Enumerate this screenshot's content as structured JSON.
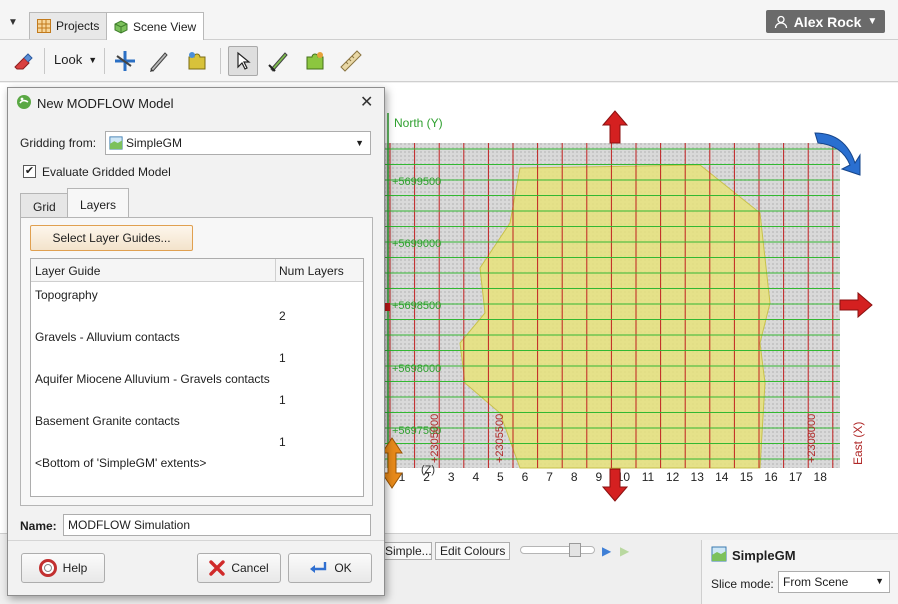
{
  "tabs": [
    {
      "label": "Projects",
      "icon": "grid-icon"
    },
    {
      "label": "Scene View",
      "icon": "cube-icon"
    }
  ],
  "user": {
    "name": "Alex Rock"
  },
  "toolbar": {
    "look_label": "Look"
  },
  "scene": {
    "north_label": "North (Y)",
    "east_label": "East (X)",
    "z_label": "(Z)",
    "northings": [
      "+5699500",
      "+5699000",
      "+5698500",
      "+5698000",
      "+5697500"
    ],
    "eastings": [
      "+2305000",
      "+2305500",
      "+2308000"
    ],
    "col_numbers": [
      "1",
      "2",
      "3",
      "4",
      "5",
      "6",
      "7",
      "8",
      "9",
      "10",
      "11",
      "12",
      "13",
      "14",
      "15",
      "16",
      "17",
      "18"
    ]
  },
  "bottom": {
    "style_value": "Simple...",
    "edit_colours": "Edit Colours",
    "props_title": "SimpleGM",
    "slice_mode_label": "Slice mode:",
    "slice_mode_value": "From Scene"
  },
  "dialog": {
    "title": "New MODFLOW Model",
    "gridding_from_label": "Gridding from:",
    "gridding_from_value": "SimpleGM",
    "evaluate_label": "Evaluate Gridded Model",
    "evaluate_checked": true,
    "tabs": [
      "Grid",
      "Layers"
    ],
    "active_tab": "Layers",
    "select_guides_button": "Select Layer Guides...",
    "table_headers": [
      "Layer Guide",
      "Num Layers"
    ],
    "guides": [
      {
        "name": "Topography",
        "num_layers": "2"
      },
      {
        "name": "Gravels - Alluvium contacts",
        "num_layers": "1"
      },
      {
        "name": "Aquifer Miocene Alluvium - Gravels contacts",
        "num_layers": "1"
      },
      {
        "name": "Basement Granite contacts",
        "num_layers": "1"
      },
      {
        "name": "<Bottom of 'SimpleGM' extents>",
        "num_layers": ""
      }
    ],
    "name_label": "Name:",
    "name_value": "MODFLOW Simulation",
    "help_button": "Help",
    "cancel_button": "Cancel",
    "ok_button": "OK"
  }
}
